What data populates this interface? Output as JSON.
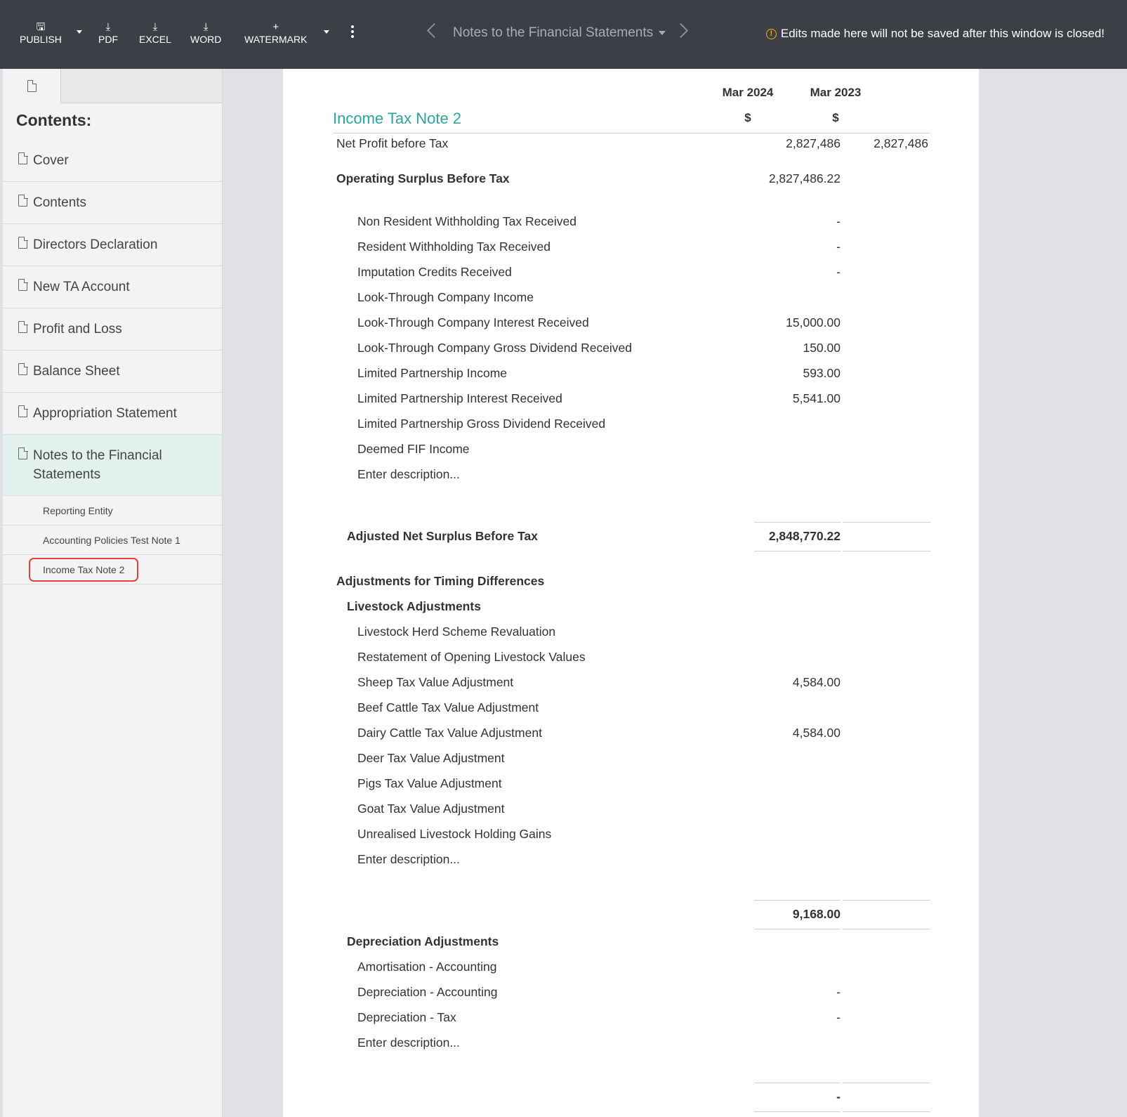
{
  "toolbar": {
    "publish": "PUBLISH",
    "pdf": "PDF",
    "excel": "EXCEL",
    "word": "WORD",
    "watermark": "WATERMARK",
    "nav_title": "Notes to the Financial Statements",
    "warning": "Edits made here will not be saved after this window is closed!"
  },
  "sidebar": {
    "heading": "Contents:",
    "items": [
      {
        "label": "Cover"
      },
      {
        "label": "Contents"
      },
      {
        "label": "Directors Declaration"
      },
      {
        "label": "New TA Account"
      },
      {
        "label": "Profit and Loss"
      },
      {
        "label": "Balance Sheet"
      },
      {
        "label": "Appropriation Statement"
      },
      {
        "label": "Notes to the Financial Statements"
      }
    ],
    "sub_items": [
      {
        "label": "Reporting Entity"
      },
      {
        "label": "Accounting Policies Test Note 1"
      },
      {
        "label": "Income Tax Note 2"
      }
    ]
  },
  "document": {
    "title": "Income Tax Note 2",
    "col1_year": "Mar 2024",
    "col2_year": "Mar 2023",
    "col1_unit": "$",
    "col2_unit": "$",
    "rows": [
      {
        "label": "Net Profit before Tax",
        "v1": "2,827,486",
        "v2": "2,827,486"
      },
      {
        "label": "Operating Surplus Before Tax",
        "v1": "2,827,486.22",
        "v2": ""
      },
      {
        "label": "Non Resident Withholding Tax Received",
        "v1": "-",
        "v2": ""
      },
      {
        "label": "Resident Withholding Tax Received",
        "v1": "-",
        "v2": ""
      },
      {
        "label": "Imputation Credits Received",
        "v1": "-",
        "v2": ""
      },
      {
        "label": "Look-Through Company Income",
        "v1": "",
        "v2": ""
      },
      {
        "label": "Look-Through Company Interest Received",
        "v1": "15,000.00",
        "v2": ""
      },
      {
        "label": "Look-Through Company Gross Dividend Received",
        "v1": "150.00",
        "v2": ""
      },
      {
        "label": "Limited Partnership Income",
        "v1": "593.00",
        "v2": ""
      },
      {
        "label": "Limited Partnership Interest Received",
        "v1": "5,541.00",
        "v2": ""
      },
      {
        "label": "Limited Partnership Gross Dividend Received",
        "v1": "",
        "v2": ""
      },
      {
        "label": "Deemed FIF Income",
        "v1": "",
        "v2": ""
      },
      {
        "label": "Enter description...",
        "v1": "",
        "v2": ""
      },
      {
        "label": "Adjusted Net Surplus Before Tax",
        "v1": "2,848,770.22",
        "v2": ""
      },
      {
        "label": "Adjustments for Timing Differences",
        "v1": "",
        "v2": ""
      },
      {
        "label": "Livestock Adjustments",
        "v1": "",
        "v2": ""
      },
      {
        "label": "Livestock Herd Scheme Revaluation",
        "v1": "",
        "v2": ""
      },
      {
        "label": "Restatement of Opening Livestock Values",
        "v1": "",
        "v2": ""
      },
      {
        "label": "Sheep Tax Value Adjustment",
        "v1": "4,584.00",
        "v2": ""
      },
      {
        "label": "Beef Cattle Tax Value Adjustment",
        "v1": "",
        "v2": ""
      },
      {
        "label": "Dairy Cattle Tax Value Adjustment",
        "v1": "4,584.00",
        "v2": ""
      },
      {
        "label": "Deer Tax Value Adjustment",
        "v1": "",
        "v2": ""
      },
      {
        "label": "Pigs Tax Value Adjustment",
        "v1": "",
        "v2": ""
      },
      {
        "label": "Goat Tax Value Adjustment",
        "v1": "",
        "v2": ""
      },
      {
        "label": "Unrealised Livestock Holding Gains",
        "v1": "",
        "v2": ""
      },
      {
        "label": "Enter description...",
        "v1": "",
        "v2": ""
      },
      {
        "label": "",
        "v1": "9,168.00",
        "v2": ""
      },
      {
        "label": "Depreciation Adjustments",
        "v1": "",
        "v2": ""
      },
      {
        "label": "Amortisation - Accounting",
        "v1": "",
        "v2": ""
      },
      {
        "label": "Depreciation - Accounting",
        "v1": "-",
        "v2": ""
      },
      {
        "label": "Depreciation - Tax",
        "v1": "-",
        "v2": ""
      },
      {
        "label": "Enter description...",
        "v1": "",
        "v2": ""
      },
      {
        "label": "",
        "v1": "-",
        "v2": ""
      }
    ]
  }
}
